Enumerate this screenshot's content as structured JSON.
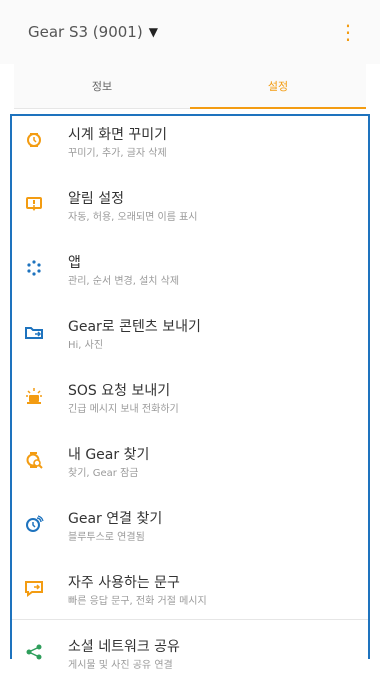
{
  "header": {
    "device_label": "Gear S3 (9001)",
    "more_label": "⋮"
  },
  "tabs": [
    {
      "label": "정보"
    },
    {
      "label": "설정"
    }
  ],
  "items": [
    {
      "title": "시계 화면 꾸미기",
      "subtitle": "꾸미기, 추가, 글자 삭제",
      "icon": "watch-face-icon",
      "color": "#f39c12"
    },
    {
      "title": "알림 설정",
      "subtitle": "자동, 허용, 오래되면 이름 표시",
      "icon": "notification-icon",
      "color": "#f39c12"
    },
    {
      "title": "앱",
      "subtitle": "관리, 순서 변경, 설치 삭제",
      "icon": "apps-icon",
      "color": "#1e73be"
    },
    {
      "title": "Gear로 콘텐츠 보내기",
      "subtitle": "Hi, 사진",
      "icon": "send-content-icon",
      "color": "#1e73be"
    },
    {
      "title": "SOS 요청 보내기",
      "subtitle": "긴급 메시지 보내 전화하기",
      "icon": "sos-icon",
      "color": "#f39c12"
    },
    {
      "title": "내 Gear 찾기",
      "subtitle": "찾기, Gear 잠금",
      "icon": "find-gear-icon",
      "color": "#f39c12"
    },
    {
      "title": "Gear 연결 찾기",
      "subtitle": "블루투스로 연결됨",
      "icon": "gear-connection-icon",
      "color": "#1e73be"
    },
    {
      "title": "자주 사용하는 문구",
      "subtitle": "빠른 응답 문구, 전화 거절 메시지",
      "icon": "quick-message-icon",
      "color": "#f39c12"
    },
    {
      "title": "소셜 네트워크 공유",
      "subtitle": "게시물 및 사진 공유 연결",
      "icon": "share-icon",
      "color": "#2e9e5b"
    }
  ]
}
